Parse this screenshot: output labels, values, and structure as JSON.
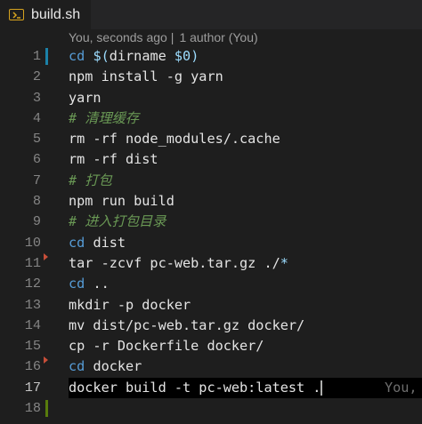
{
  "tab": {
    "title": "build.sh",
    "icon": "terminal-file-icon",
    "icon_color": "#d6a31f"
  },
  "codelens": {
    "when": "You, seconds ago",
    "separator": "|",
    "authors": "1 author (You)"
  },
  "lines": [
    {
      "number": "1",
      "parts": [
        [
          "kw",
          "cd"
        ],
        [
          "t",
          " "
        ],
        [
          "var",
          "$("
        ],
        [
          "t",
          "dirname "
        ],
        [
          "var",
          "$0"
        ],
        [
          "var",
          ")"
        ]
      ],
      "change": "modified"
    },
    {
      "number": "2",
      "parts": [
        [
          "t",
          "npm install -g yarn"
        ]
      ]
    },
    {
      "number": "3",
      "parts": [
        [
          "t",
          "yarn"
        ]
      ]
    },
    {
      "number": "4",
      "parts": [
        [
          "cmt",
          "# 清理缓存"
        ]
      ]
    },
    {
      "number": "5",
      "parts": [
        [
          "t",
          "rm -rf node_modules/.cache"
        ]
      ]
    },
    {
      "number": "6",
      "parts": [
        [
          "t",
          "rm -rf dist"
        ]
      ]
    },
    {
      "number": "7",
      "parts": [
        [
          "cmt",
          "# 打包"
        ]
      ]
    },
    {
      "number": "8",
      "parts": [
        [
          "t",
          "npm run build"
        ]
      ]
    },
    {
      "number": "9",
      "parts": [
        [
          "cmt",
          "# 进入打包目录"
        ]
      ]
    },
    {
      "number": "10",
      "parts": [
        [
          "kw",
          "cd"
        ],
        [
          "t",
          " dist"
        ]
      ]
    },
    {
      "number": "11",
      "parts": [
        [
          "t",
          "tar -zcvf pc-web.tar.gz ./"
        ],
        [
          "var",
          "*"
        ]
      ],
      "deleted_marker": true
    },
    {
      "number": "12",
      "parts": [
        [
          "kw",
          "cd"
        ],
        [
          "t",
          " .."
        ]
      ]
    },
    {
      "number": "13",
      "parts": [
        [
          "t",
          "mkdir -p docker"
        ]
      ]
    },
    {
      "number": "14",
      "parts": [
        [
          "t",
          "mv dist/pc-web.tar.gz docker/"
        ]
      ]
    },
    {
      "number": "15",
      "parts": [
        [
          "t",
          "cp -r Dockerfile docker/"
        ]
      ]
    },
    {
      "number": "16",
      "parts": [
        [
          "kw",
          "cd"
        ],
        [
          "t",
          " docker"
        ]
      ],
      "deleted_marker": true
    },
    {
      "number": "17",
      "parts": [
        [
          "t",
          "docker build -t pc-web:latest ."
        ]
      ],
      "current": true,
      "blame": "You,"
    },
    {
      "number": "18",
      "parts": [],
      "change": "added"
    }
  ],
  "colors": {
    "keyword": "#569cd6",
    "variable": "#9cdcfe",
    "comment": "#6a9955",
    "modified_bar": "#1b81a8",
    "added_bar": "#587c0c",
    "deleted_marker": "#c74e39"
  }
}
